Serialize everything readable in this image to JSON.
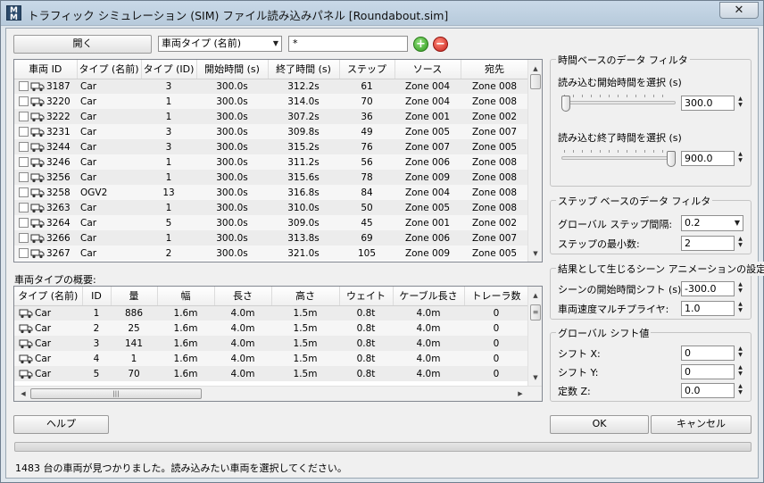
{
  "window": {
    "icon_label": "M",
    "title": "トラフィック シミュレーション (SIM) ファイル読み込みパネル [Roundabout.sim]",
    "close_glyph": "✕"
  },
  "toolbar": {
    "open_label": "開く",
    "filter_select": "車両タイプ (名前)",
    "filter_text": "*",
    "add_glyph": "+",
    "remove_glyph": "−"
  },
  "vehicle_table": {
    "columns": [
      "車両 ID",
      "タイプ (名前)",
      "タイプ (ID)",
      "開始時間 (s)",
      "終了時間 (s)",
      "ステップ",
      "ソース",
      "宛先"
    ],
    "rows": [
      [
        "3187",
        "Car",
        "3",
        "300.0s",
        "312.2s",
        "61",
        "Zone 004",
        "Zone 008"
      ],
      [
        "3220",
        "Car",
        "1",
        "300.0s",
        "314.0s",
        "70",
        "Zone 004",
        "Zone 008"
      ],
      [
        "3222",
        "Car",
        "1",
        "300.0s",
        "307.2s",
        "36",
        "Zone 001",
        "Zone 002"
      ],
      [
        "3231",
        "Car",
        "3",
        "300.0s",
        "309.8s",
        "49",
        "Zone 005",
        "Zone 007"
      ],
      [
        "3244",
        "Car",
        "3",
        "300.0s",
        "315.2s",
        "76",
        "Zone 007",
        "Zone 005"
      ],
      [
        "3246",
        "Car",
        "1",
        "300.0s",
        "311.2s",
        "56",
        "Zone 006",
        "Zone 008"
      ],
      [
        "3256",
        "Car",
        "1",
        "300.0s",
        "315.6s",
        "78",
        "Zone 009",
        "Zone 008"
      ],
      [
        "3258",
        "OGV2",
        "13",
        "300.0s",
        "316.8s",
        "84",
        "Zone 004",
        "Zone 008"
      ],
      [
        "3263",
        "Car",
        "1",
        "300.0s",
        "310.0s",
        "50",
        "Zone 005",
        "Zone 008"
      ],
      [
        "3264",
        "Car",
        "5",
        "300.0s",
        "309.0s",
        "45",
        "Zone 001",
        "Zone 002"
      ],
      [
        "3266",
        "Car",
        "1",
        "300.0s",
        "313.8s",
        "69",
        "Zone 006",
        "Zone 007"
      ],
      [
        "3267",
        "Car",
        "2",
        "300.0s",
        "321.0s",
        "105",
        "Zone 009",
        "Zone 005"
      ]
    ]
  },
  "summary": {
    "label": "車両タイプの概要:",
    "columns": [
      "タイプ (名前)",
      "ID",
      "量",
      "幅",
      "長さ",
      "高さ",
      "ウェイト",
      "ケーブル長さ",
      "トレーラ数"
    ],
    "rows": [
      [
        "Car",
        "1",
        "886",
        "1.6m",
        "4.0m",
        "1.5m",
        "0.8t",
        "4.0m",
        "0"
      ],
      [
        "Car",
        "2",
        "25",
        "1.6m",
        "4.0m",
        "1.5m",
        "0.8t",
        "4.0m",
        "0"
      ],
      [
        "Car",
        "3",
        "141",
        "1.6m",
        "4.0m",
        "1.5m",
        "0.8t",
        "4.0m",
        "0"
      ],
      [
        "Car",
        "4",
        "1",
        "1.6m",
        "4.0m",
        "1.5m",
        "0.8t",
        "4.0m",
        "0"
      ],
      [
        "Car",
        "5",
        "70",
        "1.6m",
        "4.0m",
        "1.5m",
        "0.8t",
        "4.0m",
        "0"
      ]
    ]
  },
  "time_filter": {
    "title": "時間ベースのデータ フィルタ",
    "start_label": "読み込む開始時間を選択 (s)",
    "start_value": "300.0",
    "start_slider_level": 0.0,
    "end_label": "読み込む終了時間を選択 (s)",
    "end_value": "900.0",
    "end_slider_level": 1.0
  },
  "step_filter": {
    "title": "ステップ ベースのデータ フィルタ",
    "interval_label": "グローバル ステップ間隔:",
    "interval_value": "0.2",
    "min_label": "ステップの最小数:",
    "min_value": "2"
  },
  "animation": {
    "title": "結果として生じるシーン アニメーションの設定",
    "start_shift_label": "シーンの開始時間シフト (s):",
    "start_shift_value": "-300.0",
    "speed_label": "車両速度マルチプライヤ:",
    "speed_value": "1.0"
  },
  "global_shift": {
    "title": "グローバル シフト値",
    "x_label": "シフト X:",
    "x_value": "0",
    "y_label": "シフト Y:",
    "y_value": "0",
    "z_label": "定数 Z:",
    "z_value": "0.0"
  },
  "footer": {
    "help_label": "ヘルプ",
    "ok_label": "OK",
    "cancel_label": "キャンセル",
    "progress_level": 0.0,
    "status": "1483 台の車両が見つかりました。読み込みたい車両を選択してください。"
  },
  "glyphs": {
    "up": "▲",
    "down": "▼",
    "left": "◀",
    "right": "▶",
    "grip_h": "|||",
    "grip_v": "≡"
  }
}
